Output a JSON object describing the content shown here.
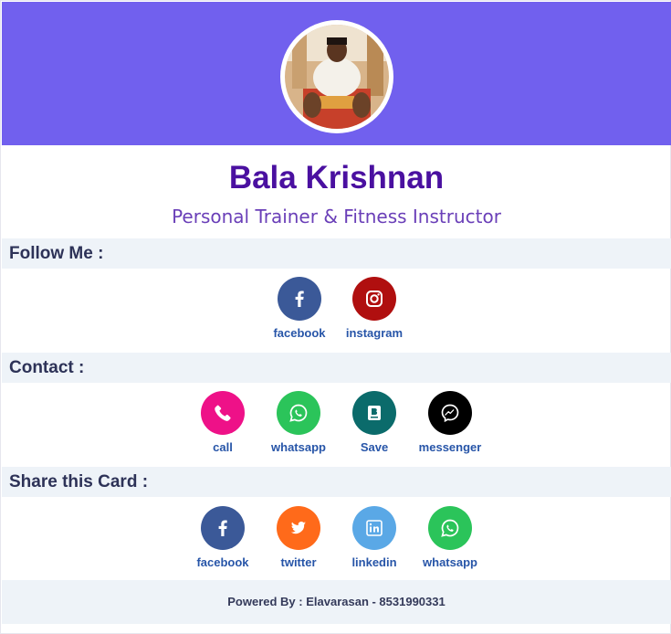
{
  "profile": {
    "name": "Bala Krishnan",
    "title": "Personal Trainer & Fitness Instructor",
    "header_color": "#7160ee"
  },
  "follow": {
    "heading": "Follow Me :",
    "items": [
      {
        "label": "facebook",
        "icon": "facebook-icon",
        "color": "#3b5998"
      },
      {
        "label": "instagram",
        "icon": "instagram-icon",
        "color": "#b00f0f"
      }
    ]
  },
  "contact": {
    "heading": "Contact :",
    "items": [
      {
        "label": "call",
        "icon": "phone-icon",
        "color": "#ee1188"
      },
      {
        "label": "whatsapp",
        "icon": "whatsapp-icon",
        "color": "#2bc45a"
      },
      {
        "label": "Save",
        "icon": "contact-card-icon",
        "color": "#0b6b6b"
      },
      {
        "label": "messenger",
        "icon": "messenger-icon",
        "color": "#000000"
      }
    ]
  },
  "share": {
    "heading": "Share this Card :",
    "items": [
      {
        "label": "facebook",
        "icon": "facebook-icon",
        "color": "#3b5998"
      },
      {
        "label": "twitter",
        "icon": "twitter-icon",
        "color": "#ff6a1a"
      },
      {
        "label": "linkedin",
        "icon": "linkedin-icon",
        "color": "#5aa8e6"
      },
      {
        "label": "whatsapp",
        "icon": "whatsapp-icon",
        "color": "#2bc45a"
      }
    ]
  },
  "footer": {
    "text": "Powered By : Elavarasan - 8531990331"
  }
}
